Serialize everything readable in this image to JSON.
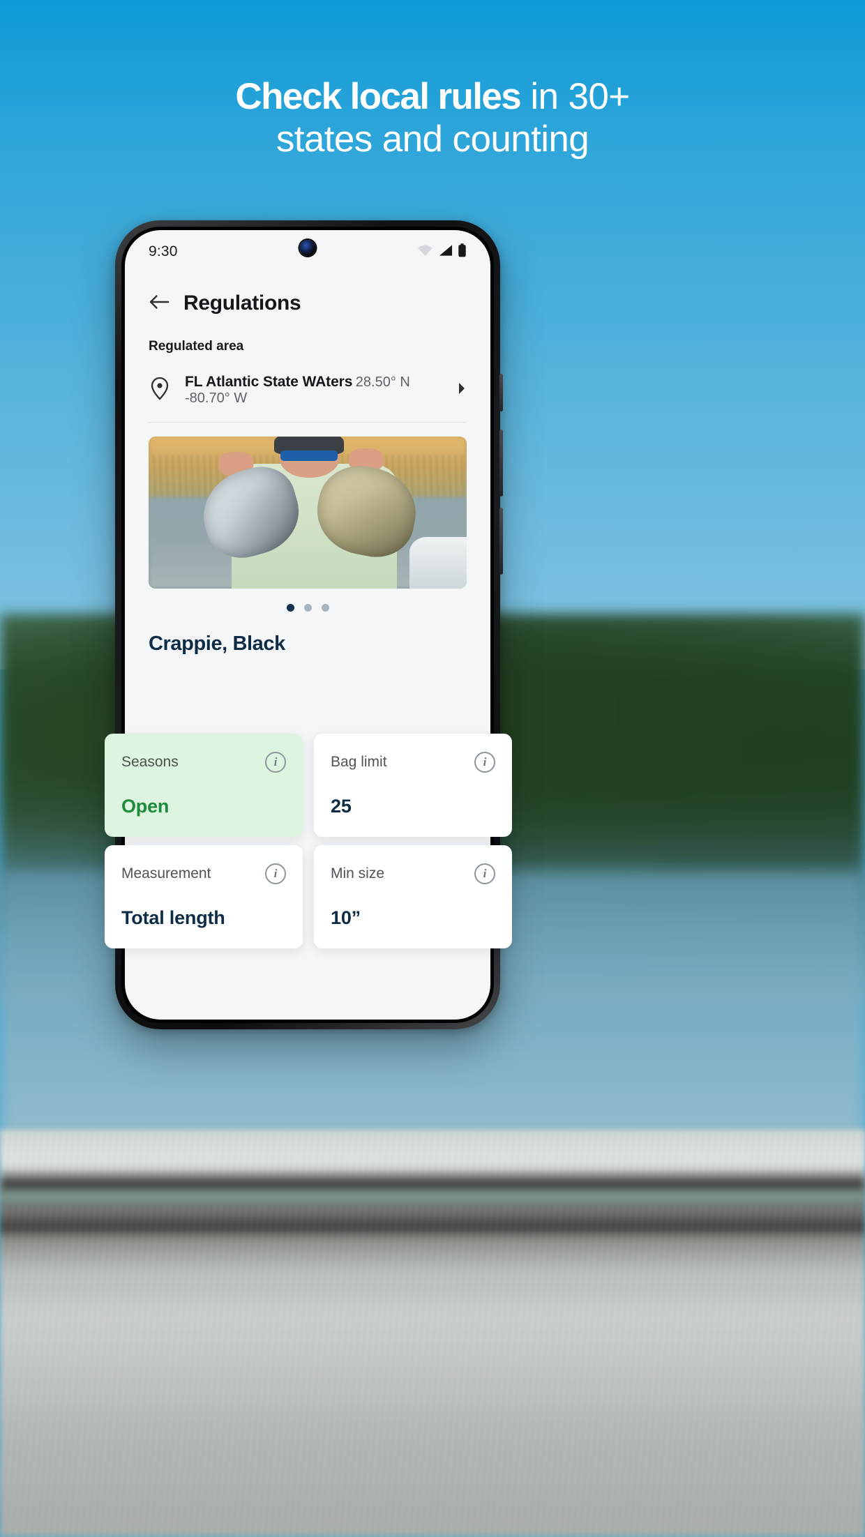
{
  "headline": {
    "line1_strong": "Check local rules",
    "line1_light": " in 30+",
    "line2": "states and counting"
  },
  "phone": {
    "status": {
      "time": "9:30",
      "wifi_icon": "wifi-icon",
      "signal_icon": "cellular-signal-icon",
      "battery_icon": "battery-icon",
      "camera": "front-camera-punch-hole"
    },
    "header": {
      "back_icon": "back-arrow-icon",
      "title": "Regulations"
    },
    "regulated_area": {
      "section_label": "Regulated area",
      "pin_icon": "location-pin-icon",
      "name": "FL Atlantic State WAters",
      "coordinates": "28.50° N -80.70° W",
      "chevron_icon": "chevron-right-icon"
    },
    "carousel": {
      "image_alt": "angler-holding-two-black-crappie",
      "dots": 3,
      "active_index": 0
    },
    "species_name": "Crappie, Black",
    "cards": [
      {
        "label": "Seasons",
        "value": "Open",
        "info_icon": "info-icon",
        "highlight": true
      },
      {
        "label": "Bag limit",
        "value": "25",
        "info_icon": "info-icon",
        "highlight": false
      },
      {
        "label": "Measurement",
        "value": "Total length",
        "info_icon": "info-icon",
        "highlight": false
      },
      {
        "label": "Min size",
        "value": "10”",
        "info_icon": "info-icon",
        "highlight": false
      }
    ]
  },
  "colors": {
    "sky_top": "#0d9ad6",
    "sky_bottom": "#82c4e2",
    "headline_text": "#ffffff",
    "open_green": "#1d8a3c",
    "card_green_bg": "#ddf4e0",
    "navy": "#0f2c46",
    "screen_bg": "#f4f6f8"
  }
}
